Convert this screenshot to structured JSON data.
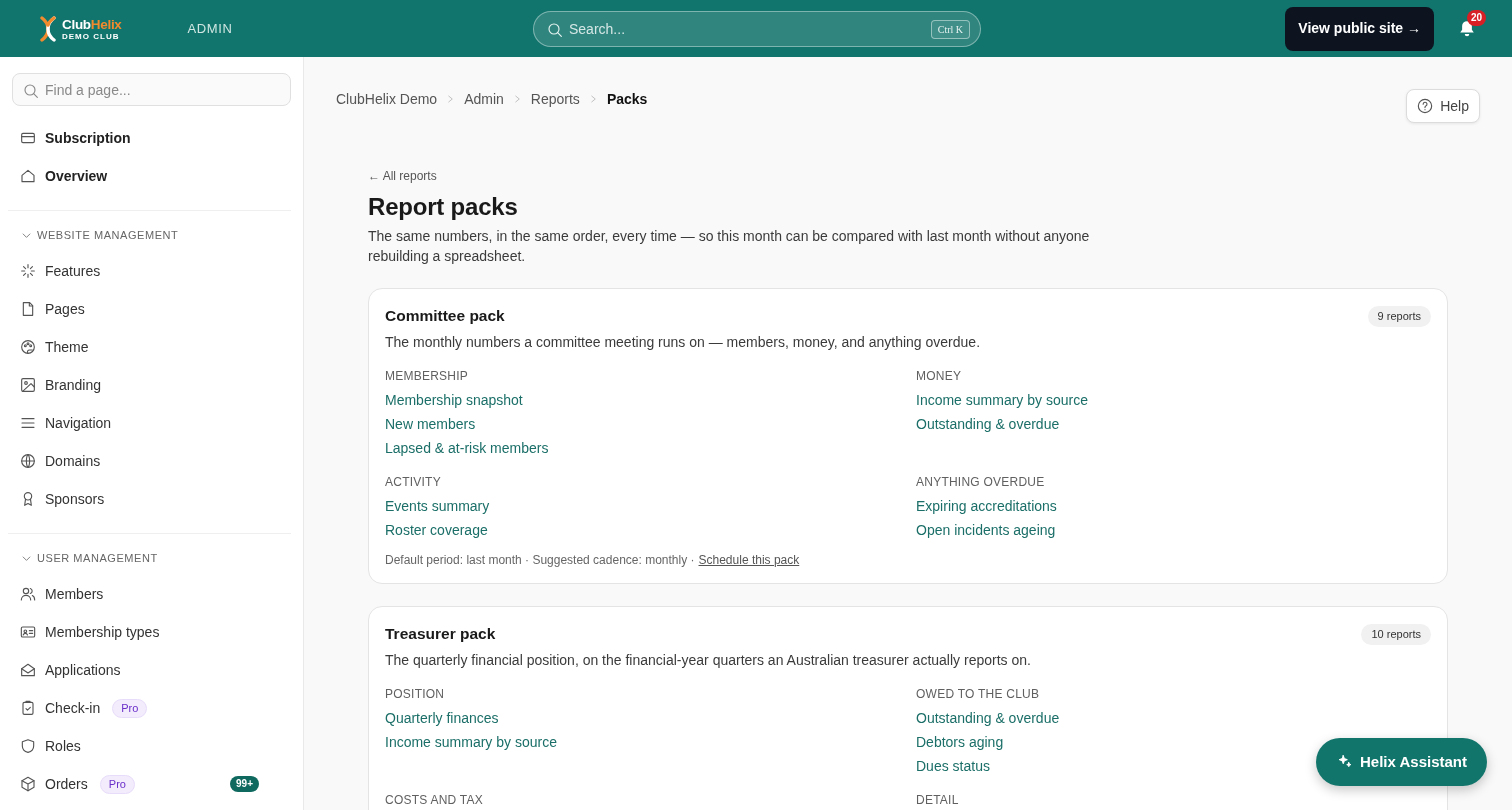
{
  "topbar": {
    "logo": {
      "name_parts": [
        "Club",
        "Helix"
      ],
      "tagline": "DEMO CLUB"
    },
    "area": "ADMIN",
    "search": {
      "placeholder": "Search...",
      "shortcut": "Ctrl K"
    },
    "public_site_button": "View public site →",
    "notification_count": "20"
  },
  "sidebar": {
    "search": {
      "placeholder": "Find a page..."
    },
    "top_items": [
      {
        "label": "Subscription"
      },
      {
        "label": "Overview"
      }
    ],
    "sections": [
      {
        "title": "WEBSITE MANAGEMENT",
        "expanded": true,
        "items": [
          {
            "label": "Features"
          },
          {
            "label": "Pages"
          },
          {
            "label": "Theme"
          },
          {
            "label": "Branding"
          },
          {
            "label": "Navigation"
          },
          {
            "label": "Domains"
          },
          {
            "label": "Sponsors"
          }
        ]
      },
      {
        "title": "USER MANAGEMENT",
        "expanded": true,
        "items": [
          {
            "label": "Members"
          },
          {
            "label": "Membership types"
          },
          {
            "label": "Applications"
          },
          {
            "label": "Check-in",
            "tag": "Pro"
          },
          {
            "label": "Roles"
          },
          {
            "label": "Orders",
            "tag": "Pro",
            "count": "99+"
          }
        ]
      }
    ]
  },
  "breadcrumb": [
    "ClubHelix Demo",
    "Admin",
    "Reports",
    "Packs"
  ],
  "help_button": "Help",
  "page": {
    "back_link": "← All reports",
    "title": "Report packs",
    "description": "The same numbers, in the same order, every time — so this month can be compared with last month without anyone rebuilding a spreadsheet."
  },
  "packs": [
    {
      "title": "Committee pack",
      "count": "9 reports",
      "description": "The monthly numbers a committee meeting runs on — members, money, and anything overdue.",
      "groups": [
        {
          "label": "MEMBERSHIP",
          "reports": [
            "Membership snapshot",
            "New members",
            "Lapsed & at-risk members"
          ]
        },
        {
          "label": "MONEY",
          "reports": [
            "Income summary by source",
            "Outstanding & overdue"
          ]
        },
        {
          "label": "ACTIVITY",
          "reports": [
            "Events summary",
            "Roster coverage"
          ]
        },
        {
          "label": "ANYTHING OVERDUE",
          "reports": [
            "Expiring accreditations",
            "Open incidents ageing"
          ]
        }
      ],
      "footer": {
        "text": "Default period: last month · Suggested cadence: monthly ·",
        "link": "Schedule this pack"
      }
    },
    {
      "title": "Treasurer pack",
      "count": "10 reports",
      "description": "The quarterly financial position, on the financial-year quarters an Australian treasurer actually reports on.",
      "groups": [
        {
          "label": "POSITION",
          "reports": [
            "Quarterly finances",
            "Income summary by source"
          ]
        },
        {
          "label": "OWED TO THE CLUB",
          "reports": [
            "Outstanding & overdue",
            "Debtors aging",
            "Dues status"
          ]
        },
        {
          "label": "COSTS AND TAX"
        },
        {
          "label": "DETAIL"
        }
      ]
    }
  ],
  "assistant_button": "Helix Assistant"
}
